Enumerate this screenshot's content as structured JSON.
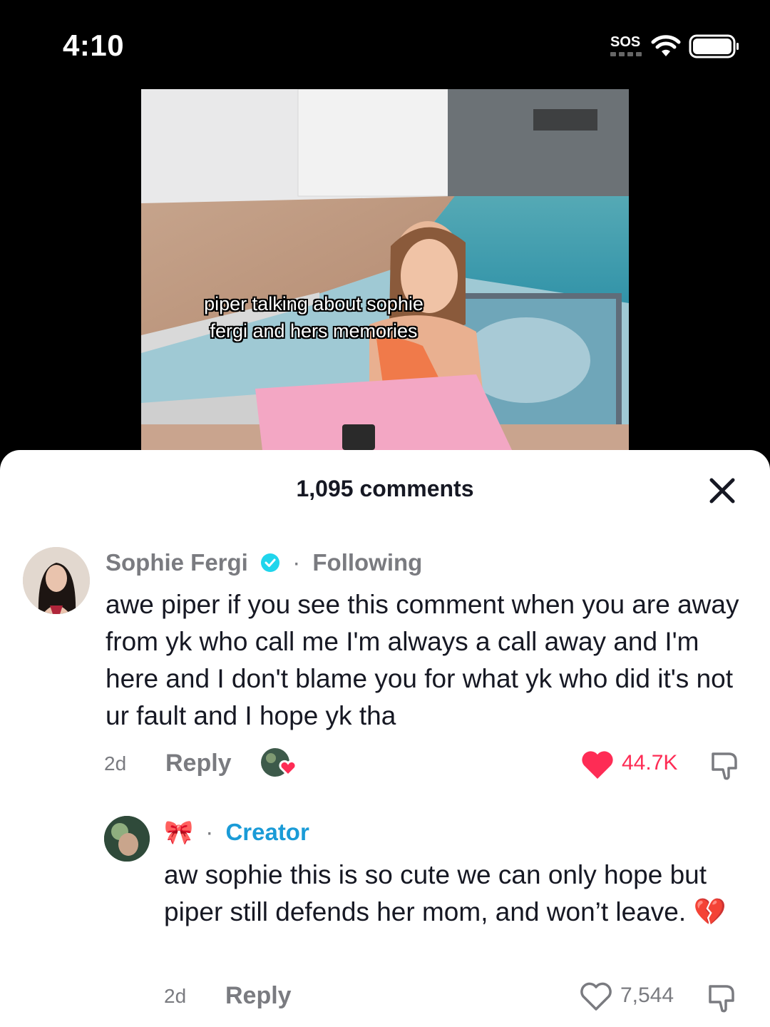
{
  "status": {
    "time": "4:10",
    "sos": "SOS"
  },
  "video": {
    "caption": "piper talking about sophie fergi and hers memories"
  },
  "comments_header": {
    "count_label": "1,095 comments"
  },
  "comments": [
    {
      "username": "Sophie Fergi",
      "separator": "·",
      "follow_status": "Following",
      "text": "awe piper if you see this comment when you are away from yk who call me I'm always a call away and I'm here and I don't blame you for what yk who did it's not ur fault and I hope yk tha",
      "age": "2d",
      "reply_label": "Reply",
      "likes": "44.7K",
      "liked": true
    },
    {
      "username": "🎀",
      "separator": "·",
      "badge": "Creator",
      "text": "aw sophie this is so cute we can only hope but piper still defends her mom, and won’t leave. 💔",
      "age": "2d",
      "reply_label": "Reply",
      "likes": "7,544",
      "liked": false
    }
  ],
  "colors": {
    "like_red": "#fe2c55",
    "creator_blue": "#1a9bd7",
    "muted": "#7a7b80",
    "text": "#161823"
  },
  "icons": [
    "wifi-icon",
    "battery-icon",
    "close-icon",
    "verified-icon",
    "heart-icon",
    "dislike-icon",
    "creator-heart-avatar-icon",
    "ribbon-emoji",
    "broken-heart-emoji"
  ]
}
